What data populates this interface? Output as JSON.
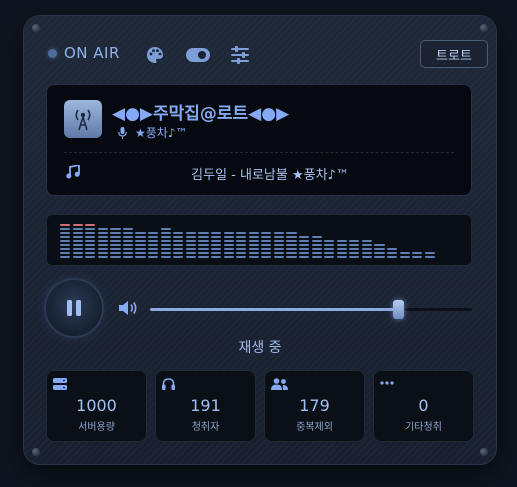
{
  "topbar": {
    "onair_label": "ON AIR",
    "icons": [
      "palette-icon",
      "toggle-icon",
      "sliders-icon"
    ],
    "trot_button_label": "트로트"
  },
  "now_playing": {
    "station_name": "◀●▶주막집@로트◀●▶",
    "dj_name": "★풍차♪™",
    "song": "김두일 - 내로남불 ★풍차♪™"
  },
  "equalizer": {
    "levels": [
      9,
      9,
      9,
      8,
      8,
      8,
      7,
      7,
      8,
      7,
      7,
      7,
      7,
      7,
      7,
      7,
      7,
      7,
      7,
      6,
      6,
      5,
      5,
      5,
      5,
      4,
      3,
      2,
      2,
      2
    ],
    "peak_levels": [
      9,
      9,
      9
    ]
  },
  "player": {
    "state": "playing",
    "volume": 0.77,
    "status_text": "재생 중"
  },
  "stats": [
    {
      "icon": "server-icon",
      "value": "1000",
      "label": "서버용량"
    },
    {
      "icon": "headphones-icon",
      "value": "191",
      "label": "청취자"
    },
    {
      "icon": "users-icon",
      "value": "179",
      "label": "중복제외"
    },
    {
      "icon": "ellipsis-icon",
      "value": "0",
      "label": "기타청취"
    }
  ],
  "colors": {
    "accent": "#85a9f2",
    "peak": "#d36b7a",
    "eq_bar": "#5f7fb2"
  }
}
